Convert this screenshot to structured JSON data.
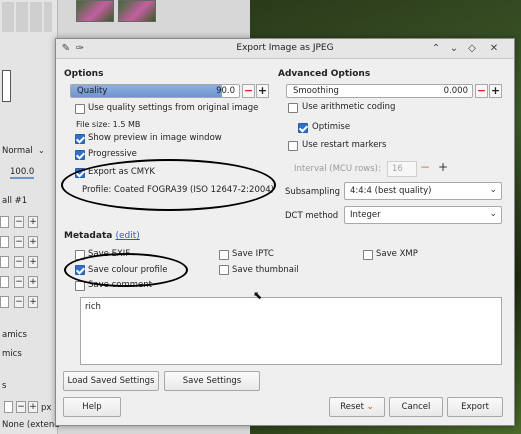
{
  "background": {
    "left_panel_texts": [
      "Normal",
      "100.0",
      "all #1",
      "amics",
      "mics",
      "s",
      "px",
      "None (extend"
    ],
    "field_zero": "0",
    "plus": "+"
  },
  "dialog": {
    "title": "Export Image as JPEG",
    "options_heading": "Options",
    "quality": {
      "label": "Quality",
      "value": "90.0",
      "fraction": 0.9
    },
    "use_quality_from_original": "Use quality settings from original image",
    "file_size": "File size: 1.5 MB",
    "show_preview": "Show preview in image window",
    "progressive": "Progressive",
    "export_cmyk": "Export as CMYK",
    "profile": "Profile: Coated FOGRA39 (ISO 12647-2:2004)",
    "advanced_heading": "Advanced Options",
    "smoothing": {
      "label": "Smoothing",
      "value": "0.000"
    },
    "use_arithmetic": "Use arithmetic coding",
    "optimise": "Optimise",
    "use_restart": "Use restart markers",
    "interval_label": "Interval (MCU rows):",
    "interval_value": "16",
    "subsampling_label": "Subsampling",
    "subsampling_value": "4:4:4 (best quality)",
    "dct_label": "DCT method",
    "dct_value": "Integer",
    "metadata_heading": "Metadata",
    "edit_link": "(edit)",
    "save_exif": "Save EXIF",
    "save_iptc": "Save IPTC",
    "save_xmp": "Save XMP",
    "save_colour_profile": "Save colour profile",
    "save_thumbnail": "Save thumbnail",
    "save_comment": "Save comment",
    "comment_text": "rich",
    "load_saved": "Load Saved Settings",
    "save_settings": "Save Settings",
    "help": "Help",
    "reset": "Reset",
    "cancel": "Cancel",
    "export": "Export"
  },
  "colors": {
    "accent": "#2f71c8",
    "minus": "#dd2222",
    "reset_arrow": "#e0601a"
  }
}
